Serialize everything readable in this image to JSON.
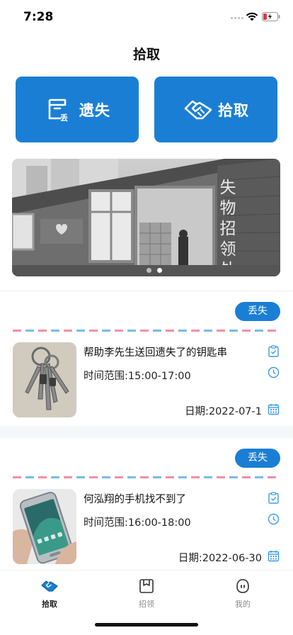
{
  "status_bar": {
    "time": "7:28"
  },
  "header": {
    "title": "拾取"
  },
  "actions": {
    "lost": {
      "label": "遗失",
      "icon": "lost-box-icon",
      "icon_badge": "丢"
    },
    "found": {
      "label": "拾取",
      "icon": "handshake-icon"
    }
  },
  "banner": {
    "sign_text": "失物招领处",
    "slides_count": 2,
    "active_slide": 2
  },
  "items": [
    {
      "tag": "丢失",
      "title": "帮助李先生送回遗失了的钥匙串",
      "time_range": "时间范围:15:00-17:00",
      "date": "日期:2022-07-1",
      "photo": "keys-photo"
    },
    {
      "tag": "丢失",
      "title": "何泓翔的手机找不到了",
      "time_range": "时间范围:16:00-18:00",
      "date": "日期:2022-06-30",
      "photo": "phone-photo"
    }
  ],
  "tab_bar": {
    "tabs": [
      {
        "label": "拾取",
        "icon": "handshake-tab-icon",
        "active": true
      },
      {
        "label": "招领",
        "icon": "box-tab-icon",
        "active": false
      },
      {
        "label": "我的",
        "icon": "profile-tab-icon",
        "active": false
      }
    ]
  },
  "colors": {
    "primary": "#1a7fd4",
    "airmail_pink": "#f18faa",
    "airmail_blue": "#79b9ee",
    "icon_blue": "#3d9be6"
  }
}
